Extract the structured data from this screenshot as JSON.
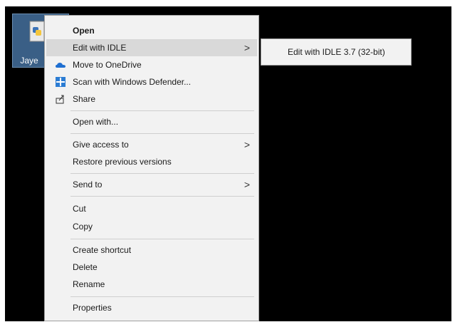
{
  "desktop": {
    "file_label": "Jaye",
    "file_icon": "python-file-icon"
  },
  "menu": {
    "open": "Open",
    "edit_idle": "Edit with IDLE",
    "onedrive": "Move to OneDrive",
    "defender": "Scan with Windows Defender...",
    "share": "Share",
    "open_with": "Open with...",
    "give_access": "Give access to",
    "restore": "Restore previous versions",
    "send_to": "Send to",
    "cut": "Cut",
    "copy": "Copy",
    "create_shortcut": "Create shortcut",
    "delete": "Delete",
    "rename": "Rename",
    "properties": "Properties",
    "chevron": ">"
  },
  "submenu": {
    "edit_idle_37": "Edit with IDLE 3.7 (32-bit)"
  },
  "colors": {
    "hover": "#d9d9d9",
    "onedrive": "#1f6fd1",
    "defender": "#2b7cd3"
  }
}
